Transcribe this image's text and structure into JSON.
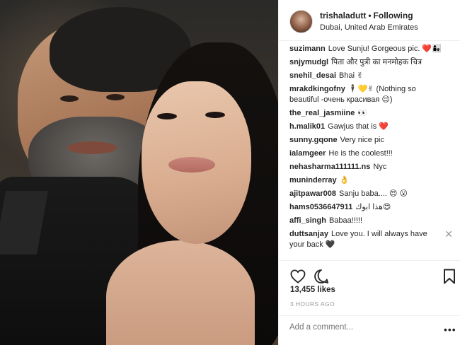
{
  "post": {
    "username": "trishaladutt",
    "separator": "•",
    "follow_status": "Following",
    "location": "Dubai, United Arab Emirates",
    "likes": "13,455 likes",
    "time": "3 HOURS AGO"
  },
  "comments": [
    {
      "user": "suzimann",
      "text": "Love Sunju! Gorgeous pic. ❤️👩‍👧"
    },
    {
      "user": "snjymudgl",
      "text": "पिता और पुत्री का मनमोहक चित्र"
    },
    {
      "user": "snehil_desai",
      "text": "Bhai ✌"
    },
    {
      "user": "mrakdkingofny",
      "text": "🕴💛✌ (Nothing so beautiful -очень красивая 😌)"
    },
    {
      "user": "the_real_jasmiine",
      "text": "👀"
    },
    {
      "user": "h.malik01",
      "text": "Gawjus that is ❤️"
    },
    {
      "user": "sunny.gqone",
      "text": "Very nice pic"
    },
    {
      "user": "ialamgeer",
      "text": "He is the coolest!!!"
    },
    {
      "user": "nehasharma111111.ns",
      "text": "Nyc"
    },
    {
      "user": "muninderray",
      "text": "👌"
    },
    {
      "user": "ajitpawar008",
      "text": "Sanju baba.... 😍 😮"
    },
    {
      "user": "hams0536647911",
      "text": "هذا ابوك😍"
    },
    {
      "user": "affi_singh",
      "text": "Babaa!!!!!"
    },
    {
      "user": "duttsanjay",
      "text": "Love you. I will always have your back 🖤"
    }
  ],
  "comment_close": "✕",
  "add_comment": {
    "placeholder": "Add a comment...",
    "more": "•••"
  },
  "icons": {
    "like": "heart-outline-icon",
    "comment": "speech-bubble-icon",
    "save": "bookmark-icon"
  },
  "colors": {
    "text": "#262626",
    "muted": "#999999",
    "border": "#efefef",
    "heart": "#ed4956"
  }
}
